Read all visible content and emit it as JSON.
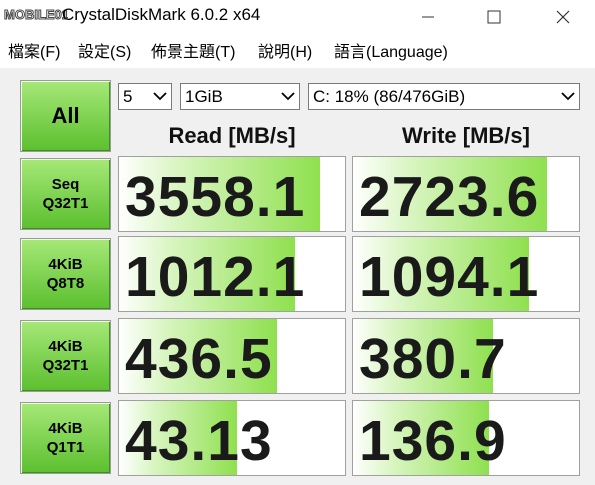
{
  "window": {
    "title": "CrystalDiskMark 6.0.2 x64",
    "logo_text": "MOBILE01"
  },
  "menu": [
    {
      "label": "檔案(F)"
    },
    {
      "label": "設定(S)"
    },
    {
      "label": "佈景主題(T)"
    },
    {
      "label": "說明(H)"
    },
    {
      "label": "語言(Language)"
    }
  ],
  "controls": {
    "all_label": "All",
    "count": "5",
    "size": "1GiB",
    "drive": "C: 18% (86/476GiB)"
  },
  "headers": {
    "read": "Read [MB/s]",
    "write": "Write [MB/s]"
  },
  "rows": [
    {
      "line1": "Seq",
      "line2": "Q32T1",
      "read": "3558.1",
      "write": "2723.6",
      "read_level": 0.89,
      "write_level": 0.86
    },
    {
      "line1": "4KiB",
      "line2": "Q8T8",
      "read": "1012.1",
      "write": "1094.1",
      "read_level": 0.78,
      "write_level": 0.78
    },
    {
      "line1": "4KiB",
      "line2": "Q32T1",
      "read": "436.5",
      "write": "380.7",
      "read_level": 0.7,
      "write_level": 0.62
    },
    {
      "line1": "4KiB",
      "line2": "Q1T1",
      "read": "43.13",
      "write": "136.9",
      "read_level": 0.52,
      "write_level": 0.6
    }
  ],
  "colors": {
    "accent_green": "#5cbf2f",
    "bar_green": "#8fe04f"
  }
}
